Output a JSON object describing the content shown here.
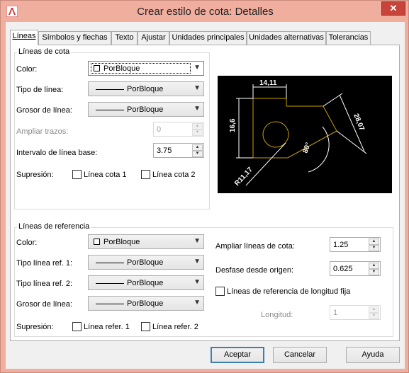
{
  "window": {
    "title": "Crear estilo de cota: Detalles",
    "close_glyph": "✕",
    "app_icon": "autocad-a-icon"
  },
  "tabs": [
    {
      "label": "Líneas",
      "active": true
    },
    {
      "label": "Símbolos y flechas"
    },
    {
      "label": "Texto"
    },
    {
      "label": "Ajustar"
    },
    {
      "label": "Unidades principales"
    },
    {
      "label": "Unidades alternativas"
    },
    {
      "label": "Tolerancias"
    }
  ],
  "dim_lines": {
    "group_title": "Líneas de cota",
    "color_label": "Color:",
    "color_value": "PorBloque",
    "linetype_label": "Tipo de línea:",
    "linetype_value": "PorBloque",
    "lineweight_label": "Grosor de línea:",
    "lineweight_value": "PorBloque",
    "extend_label": "Ampliar trazos:",
    "extend_value": "0",
    "baseline_label": "Intervalo de línea base:",
    "baseline_value": "3.75",
    "suppress_label": "Supresión:",
    "suppress_1": "Línea cota 1",
    "suppress_2": "Línea cota 2"
  },
  "preview": {
    "dim_top": "14,11",
    "dim_left": "16,6",
    "dim_right": "28,07",
    "dim_angle": "80°",
    "dim_radius": "R11,17"
  },
  "ext_lines": {
    "group_title": "Líneas de referencia",
    "color_label": "Color:",
    "color_value": "PorBloque",
    "linetype1_label": "Tipo línea ref. 1:",
    "linetype1_value": "PorBloque",
    "linetype2_label": "Tipo línea ref. 2:",
    "linetype2_value": "PorBloque",
    "lineweight_label": "Grosor de línea:",
    "lineweight_value": "PorBloque",
    "suppress_label": "Supresión:",
    "suppress_1": "Línea refer. 1",
    "suppress_2": "Línea refer. 2",
    "extend_label": "Ampliar líneas de cota:",
    "extend_value": "1.25",
    "offset_label": "Desfase desde origen:",
    "offset_value": "0.625",
    "fixed_label": "Líneas de referencia de longitud fija",
    "length_label": "Longitud:",
    "length_value": "1"
  },
  "buttons": {
    "ok": "Aceptar",
    "cancel": "Cancelar",
    "help": "Ayuda"
  }
}
